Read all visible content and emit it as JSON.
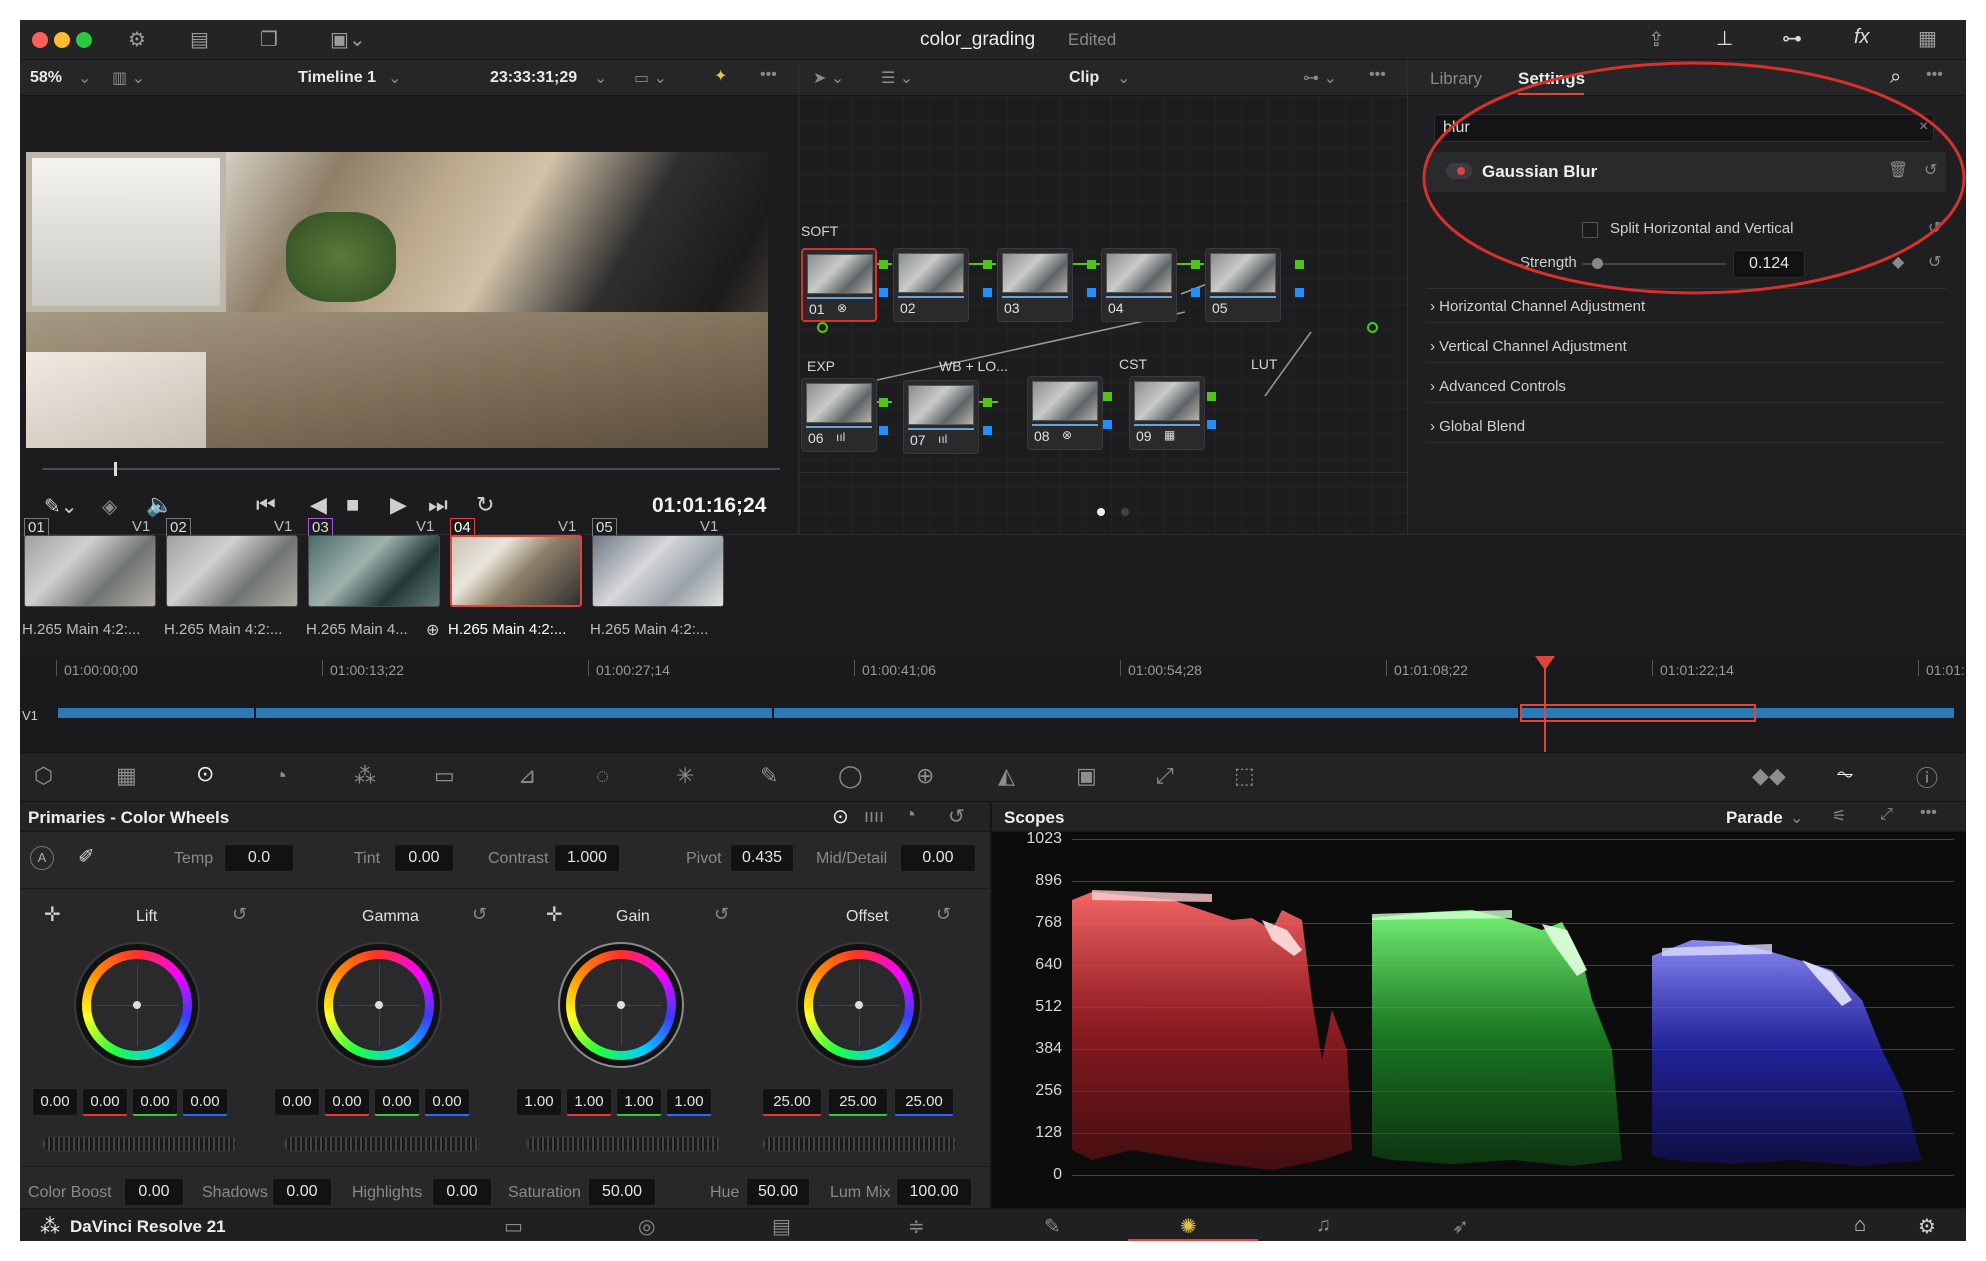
{
  "window": {
    "title": "color_grading",
    "status": "Edited"
  },
  "viewer": {
    "zoom": "58%",
    "timeline": "Timeline 1",
    "timecode": "23:33:31;29",
    "playhead_tc": "01:01:16;24"
  },
  "node_editor": {
    "mode": "Clip",
    "node_labels": {
      "n01": "SOFT",
      "n06": "EXP",
      "n07": "WB + LO...",
      "n08": "CST",
      "n09": "LUT"
    },
    "nodes": [
      "01",
      "02",
      "03",
      "04",
      "05",
      "06",
      "07",
      "08",
      "09"
    ]
  },
  "settings": {
    "tab_library": "Library",
    "tab_settings": "Settings",
    "search_value": "blur",
    "effect_name": "Gaussian Blur",
    "split_label": "Split Horizontal and Vertical",
    "strength_label": "Strength",
    "strength_value": "0.124",
    "sections": [
      "Horizontal Channel Adjustment",
      "Vertical Channel Adjustment",
      "Advanced Controls",
      "Global Blend"
    ]
  },
  "clips": [
    {
      "num": "01",
      "track": "V1",
      "name": "H.265 Main 4:2:..."
    },
    {
      "num": "02",
      "track": "V1",
      "name": "H.265 Main 4:2:..."
    },
    {
      "num": "03",
      "track": "V1",
      "name": "H.265 Main 4..."
    },
    {
      "num": "04",
      "track": "V1",
      "name": "H.265 Main 4:2:..."
    },
    {
      "num": "05",
      "track": "V1",
      "name": "H.265 Main 4:2:..."
    }
  ],
  "timeline": {
    "track": "V1",
    "timecodes": [
      "01:00:00;00",
      "01:00:13;22",
      "01:00:27;14",
      "01:00:41;06",
      "01:00:54;28",
      "01:01:08;22",
      "01:01:22;14",
      "01:01:"
    ]
  },
  "primaries": {
    "title": "Primaries - Color Wheels",
    "temp_label": "Temp",
    "temp": "0.0",
    "tint_label": "Tint",
    "tint": "0.00",
    "contrast_label": "Contrast",
    "contrast": "1.000",
    "pivot_label": "Pivot",
    "pivot": "0.435",
    "middetail_label": "Mid/Detail",
    "middetail": "0.00",
    "wheels": [
      {
        "name": "Lift",
        "values": [
          "0.00",
          "0.00",
          "0.00",
          "0.00"
        ]
      },
      {
        "name": "Gamma",
        "values": [
          "0.00",
          "0.00",
          "0.00",
          "0.00"
        ]
      },
      {
        "name": "Gain",
        "values": [
          "1.00",
          "1.00",
          "1.00",
          "1.00"
        ]
      },
      {
        "name": "Offset",
        "values": [
          "25.00",
          "25.00",
          "25.00"
        ]
      }
    ],
    "colorboost_label": "Color Boost",
    "colorboost": "0.00",
    "shadows_label": "Shadows",
    "shadows": "0.00",
    "highlights_label": "Highlights",
    "highlights": "0.00",
    "saturation_label": "Saturation",
    "saturation": "50.00",
    "hue_label": "Hue",
    "hue": "50.00",
    "lummix_label": "Lum Mix",
    "lummix": "100.00"
  },
  "scopes": {
    "title": "Scopes",
    "mode": "Parade",
    "scale": [
      "1023",
      "896",
      "768",
      "640",
      "512",
      "384",
      "256",
      "128",
      "0"
    ]
  },
  "footer": {
    "app": "DaVinci Resolve 21"
  },
  "colors": {
    "accent": "#e0443a",
    "highlight_circle": "#d9302a",
    "node_link": "#52c41a",
    "timeline_clip": "#2c79b8"
  }
}
